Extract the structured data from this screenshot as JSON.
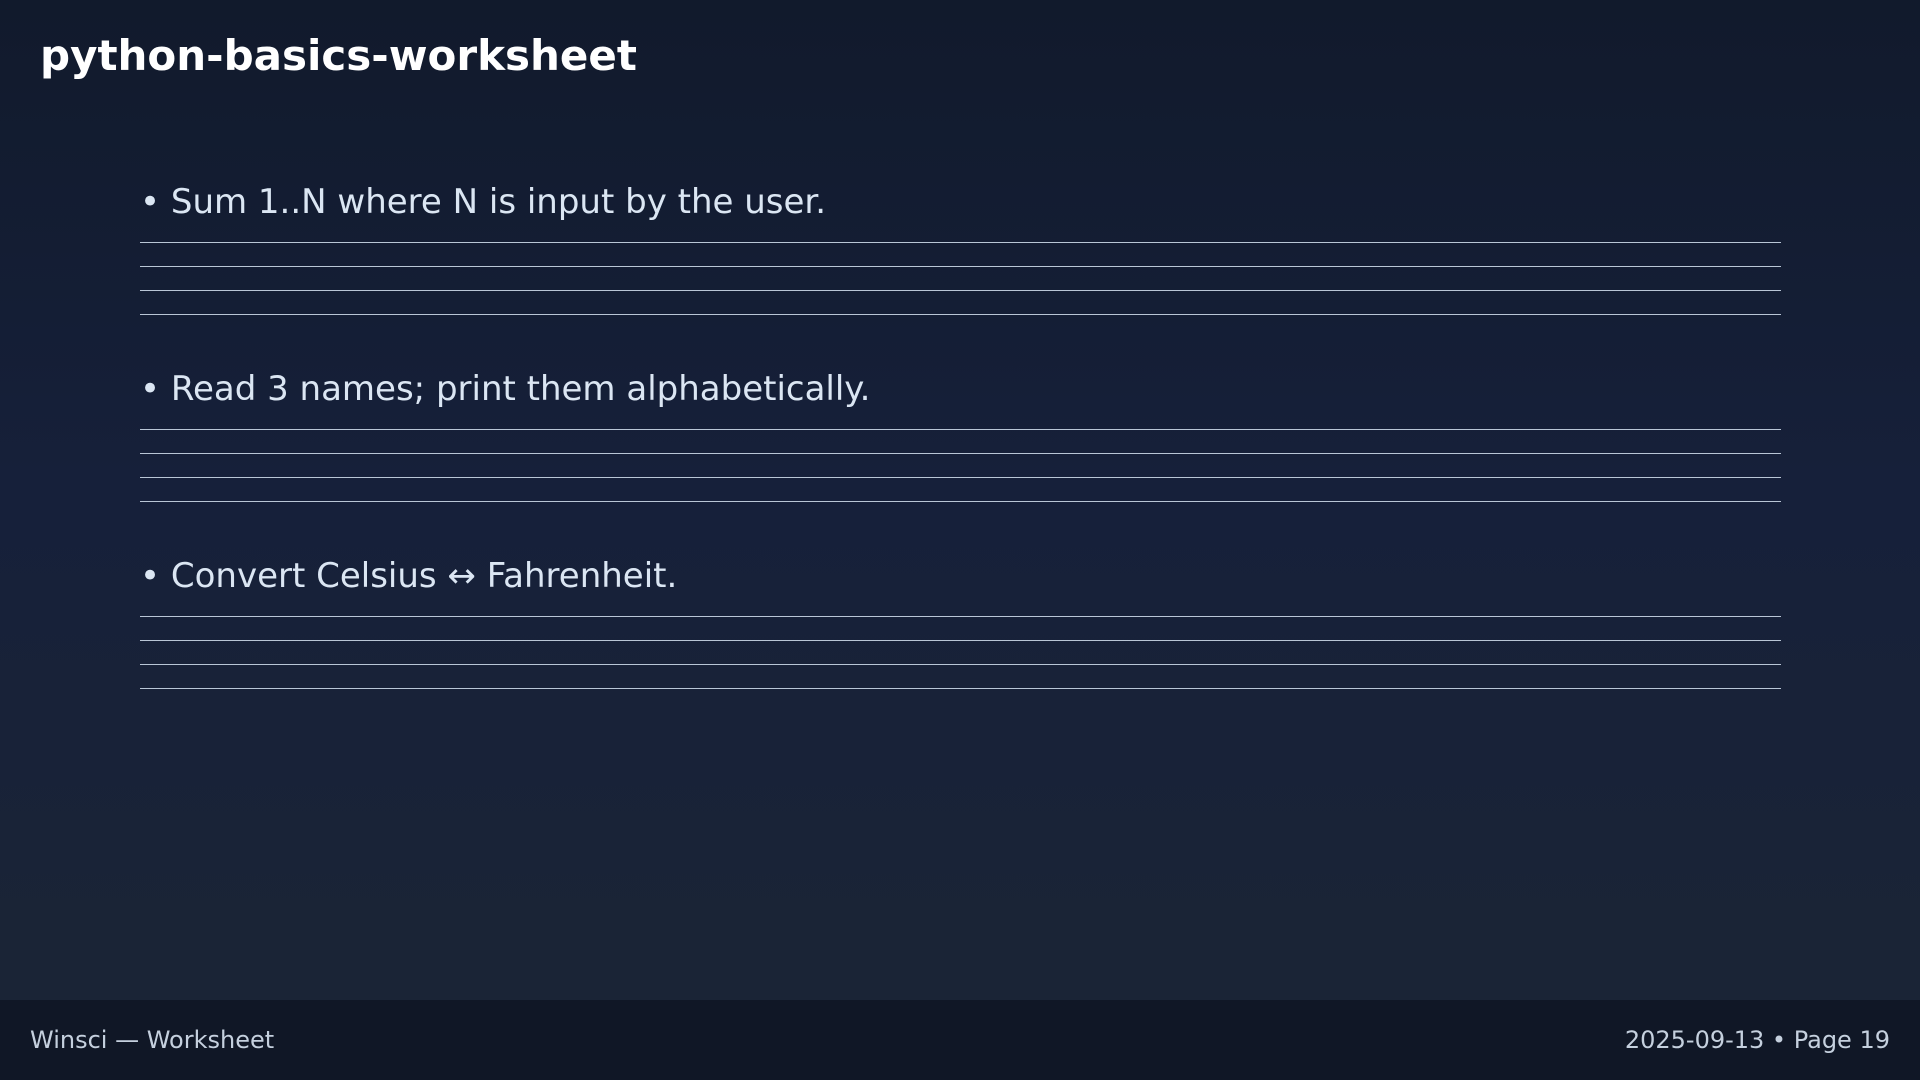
{
  "page": {
    "title": "python-basics-worksheet"
  },
  "questions": [
    {
      "text": "• Sum 1..N where N is input by the user."
    },
    {
      "text": "• Read 3 names; print them alphabetically."
    },
    {
      "text": "• Convert Celsius ↔ Fahrenheit."
    }
  ],
  "footer": {
    "left": "Winsci — Worksheet",
    "right": "2025-09-13 • Page 19"
  }
}
